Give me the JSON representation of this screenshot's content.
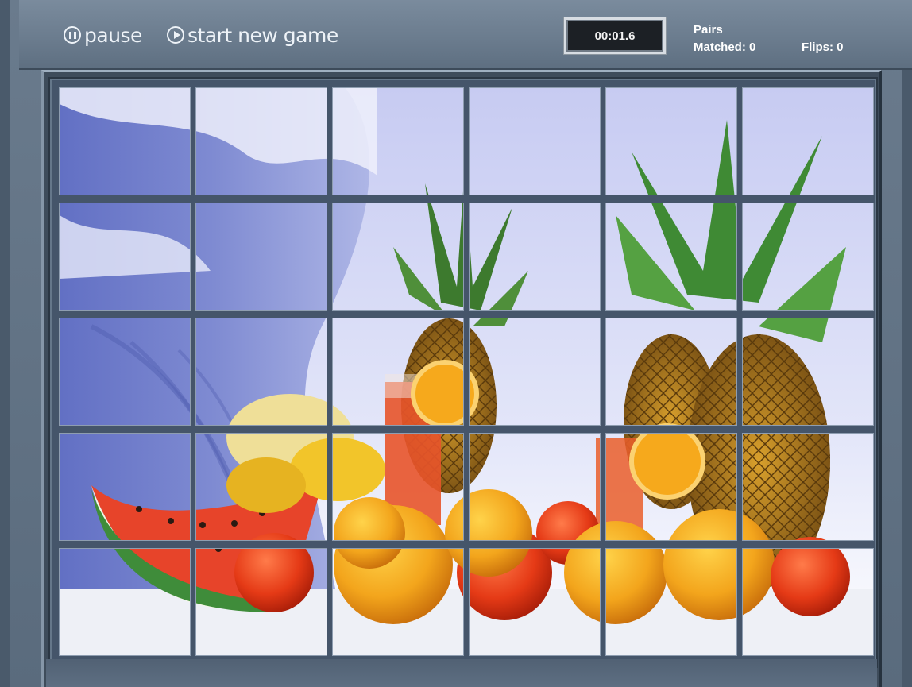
{
  "toolbar": {
    "pause_label": "pause",
    "new_game_label": "start new game",
    "pause_icon": "pause-circle-icon",
    "play_icon": "play-circle-icon"
  },
  "timer": {
    "value": "00:01.6"
  },
  "stats": {
    "pairs_label_line1": "Pairs",
    "pairs_label_line2": "Matched: 0",
    "flips_label": "Flips: 0"
  },
  "board": {
    "rows": 5,
    "columns": 6,
    "tiles_revealed": 30,
    "image_subject": "fruit still life with pineapples, oranges, watermelon and juice glasses in front of an ocean wave"
  },
  "colors": {
    "toolbar": "#6f8092",
    "timer_bg": "#1c2025",
    "text": "#ffffff"
  }
}
